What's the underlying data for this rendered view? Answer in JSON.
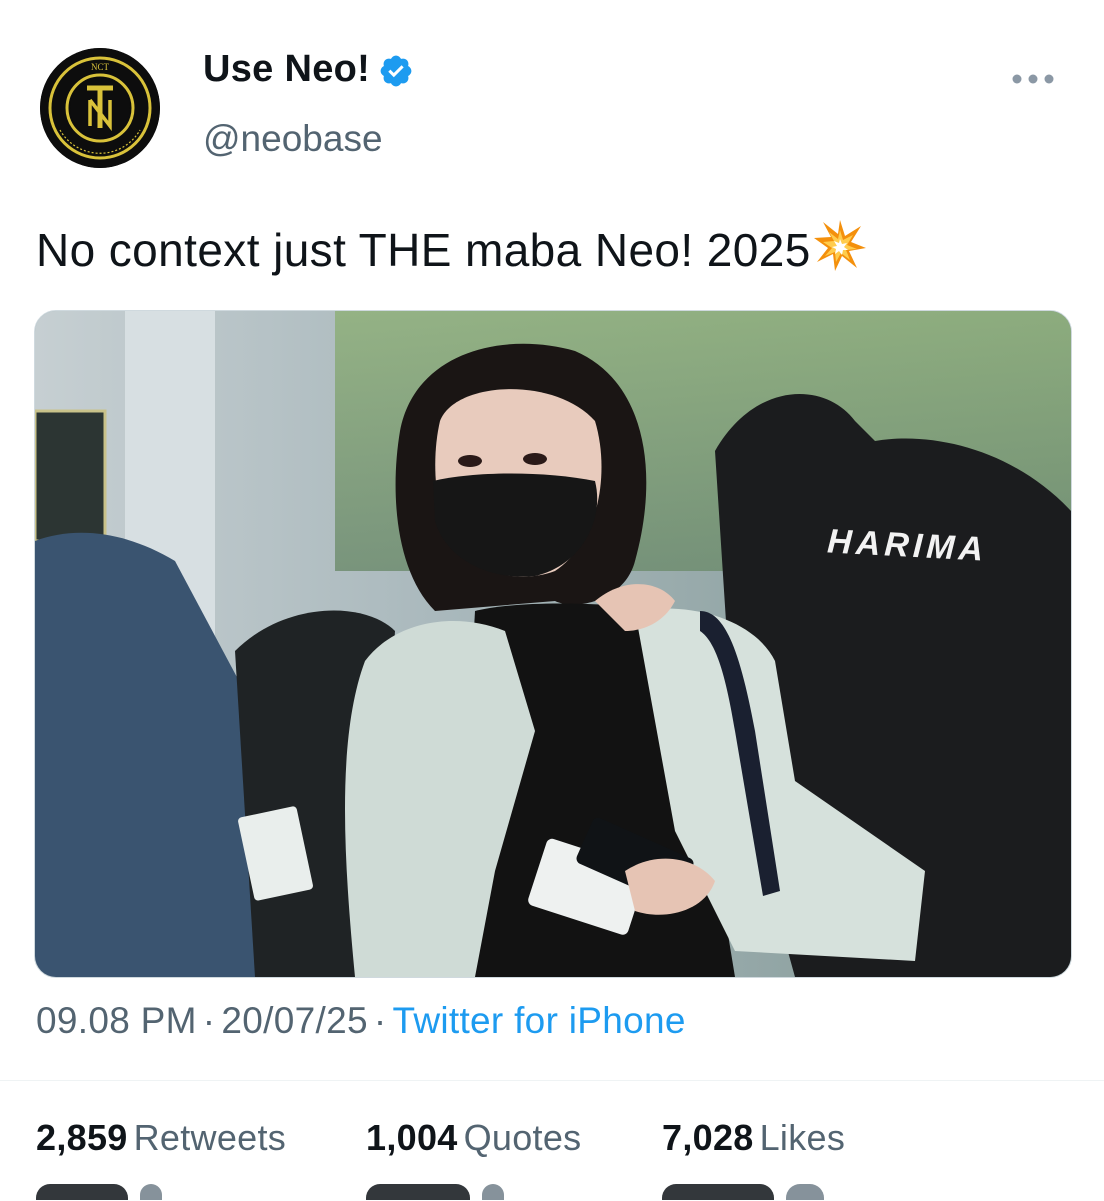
{
  "tweet": {
    "author": {
      "display_name": "Use Neo!",
      "handle": "@neobase",
      "verified": true,
      "avatar_logo": {
        "top": "NCT",
        "ring": "NEO CULTURE TECHNOLOGY"
      }
    },
    "text": "No context just THE maba Neo! 2025",
    "emoji": "collision-emoji",
    "media": {
      "jacket_print": "HARIMA"
    },
    "timestamp": {
      "time": "09.08 PM",
      "date": "20/07/25",
      "sep": "·",
      "source": "Twitter for iPhone"
    },
    "stats": [
      {
        "value": "2,859",
        "label": "Retweets"
      },
      {
        "value": "1,004",
        "label": "Quotes"
      },
      {
        "value": "7,028",
        "label": "Likes"
      }
    ]
  },
  "colors": {
    "text": "#0f1419",
    "secondary": "#536471",
    "link": "#1d9bf0",
    "verified": "#1d9bf0",
    "logo_gold": "#d9c23a"
  },
  "icons": {
    "verified": "verified-badge-icon",
    "more": "more-options-icon"
  }
}
